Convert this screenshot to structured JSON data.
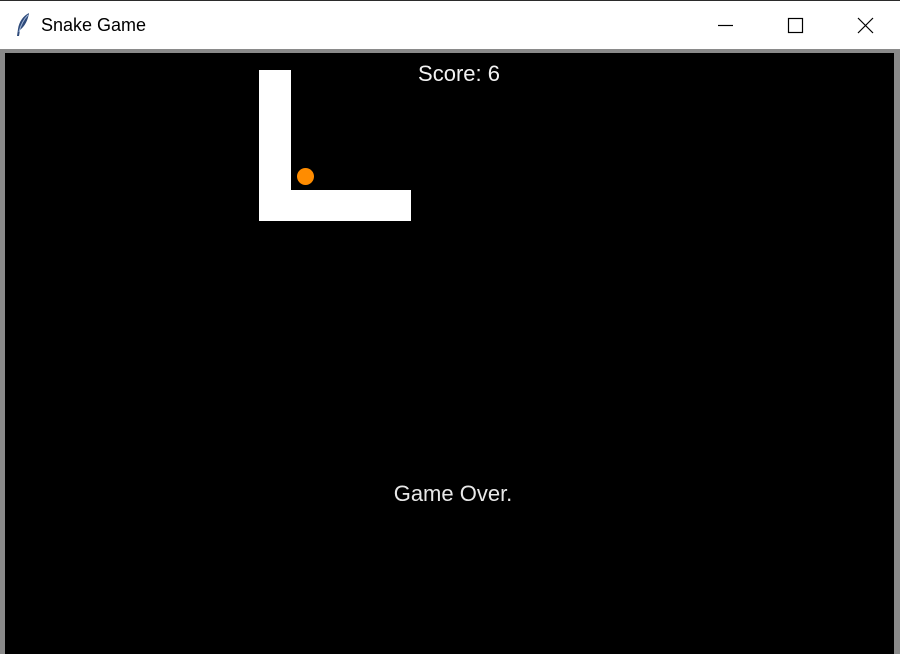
{
  "window": {
    "title": "Snake Game",
    "app_icon": "feather-icon",
    "controls": {
      "minimize_icon": "minimize-icon",
      "maximize_icon": "maximize-icon",
      "close_icon": "close-icon"
    }
  },
  "game": {
    "score_text": "Score: 6",
    "score": 6,
    "status_text": "Game Over.",
    "colors": {
      "background": "#000000",
      "snake": "#ffffff",
      "food": "#ff8c00",
      "text": "#ffffff"
    }
  }
}
